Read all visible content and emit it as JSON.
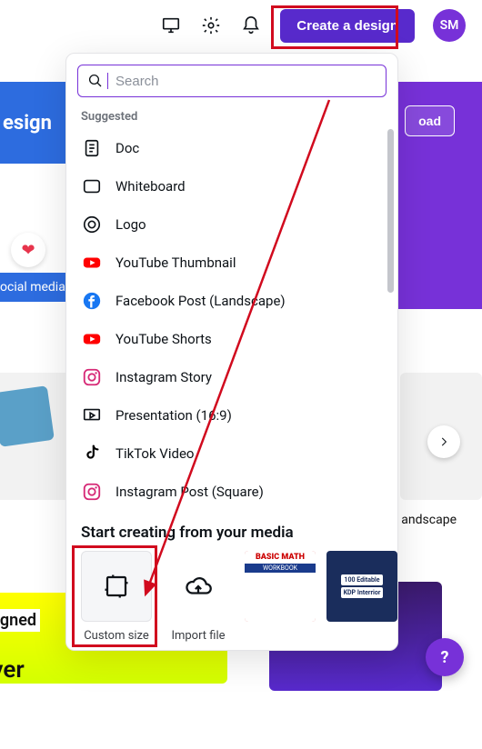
{
  "header": {
    "create_label": "Create a design",
    "avatar_initials": "SM"
  },
  "background": {
    "banner1_text": "esign",
    "upload_label": "oad",
    "tag_text": "ocial media",
    "landscape_label": "andscape"
  },
  "panel": {
    "search_placeholder": "Search",
    "suggested_label": "Suggested",
    "items": [
      {
        "icon": "doc-icon",
        "label": "Doc"
      },
      {
        "icon": "whiteboard-icon",
        "label": "Whiteboard"
      },
      {
        "icon": "logo-icon",
        "label": "Logo"
      },
      {
        "icon": "youtube-icon",
        "label": "YouTube Thumbnail"
      },
      {
        "icon": "facebook-icon",
        "label": "Facebook Post (Landscape)"
      },
      {
        "icon": "youtube-icon",
        "label": "YouTube Shorts"
      },
      {
        "icon": "instagram-icon",
        "label": "Instagram Story"
      },
      {
        "icon": "presentation-icon",
        "label": "Presentation (16:9)"
      },
      {
        "icon": "tiktok-icon",
        "label": "TikTok Video"
      },
      {
        "icon": "instagram-icon",
        "label": "Instagram Post (Square)"
      }
    ],
    "media_title": "Start creating from your media",
    "custom_size_label": "Custom size",
    "import_file_label": "Import file",
    "thumb_math_head": "BASIC MATH",
    "thumb_math_sub": "WORKBOOK",
    "thumb_kdp_top": "100 Editable",
    "thumb_kdp_bot": "KDP Interrior"
  },
  "strip": {
    "signed": "signed",
    "over": "over"
  },
  "help_label": "?",
  "colors": {
    "brand": "#7731d8",
    "annot": "#d10a1e"
  }
}
